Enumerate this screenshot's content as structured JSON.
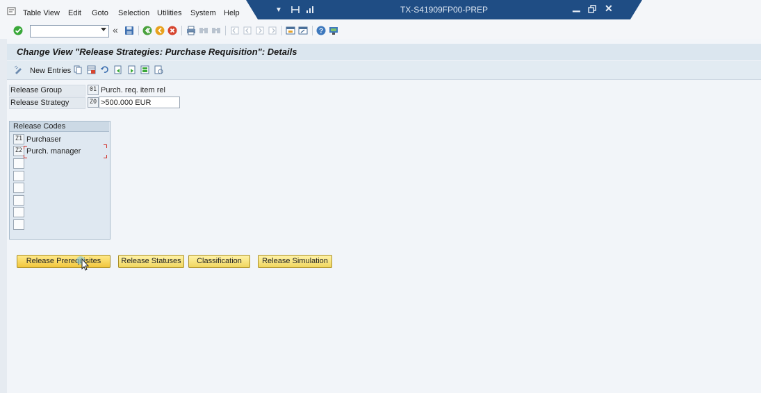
{
  "window": {
    "title": "TX-S41909FP00-PREP"
  },
  "menu": {
    "items": [
      {
        "label": "Table View"
      },
      {
        "label": "Edit"
      },
      {
        "label": "Goto"
      },
      {
        "label": "Selection"
      },
      {
        "label": "Utilities"
      },
      {
        "label": "System"
      },
      {
        "label": "Help"
      }
    ]
  },
  "toolbar": {
    "command_value": ""
  },
  "page": {
    "title": "Change View \"Release Strategies: Purchase Requisition\": Details",
    "new_entries_label": "New Entries"
  },
  "form": {
    "release_group": {
      "label": "Release Group",
      "code": "01",
      "description": "Purch. req. item rel"
    },
    "release_strategy": {
      "label": "Release Strategy",
      "code": "Z0",
      "description": ">500.000 EUR"
    }
  },
  "release_codes": {
    "header": "Release Codes",
    "rows": [
      {
        "code": "Z1",
        "description": "Purchaser"
      },
      {
        "code": "Z2",
        "description": "Purch. manager"
      },
      {
        "code": "",
        "description": ""
      },
      {
        "code": "",
        "description": ""
      },
      {
        "code": "",
        "description": ""
      },
      {
        "code": "",
        "description": ""
      },
      {
        "code": "",
        "description": ""
      },
      {
        "code": "",
        "description": ""
      }
    ]
  },
  "buttons": {
    "release_prerequisites": "Release Prerequisites",
    "release_statuses": "Release Statuses",
    "classification": "Classification",
    "release_simulation": "Release Simulation"
  },
  "colors": {
    "title_bar": "#1f4d84",
    "button_fill": "#f0d65e",
    "accent_green": "#3aa83a"
  }
}
